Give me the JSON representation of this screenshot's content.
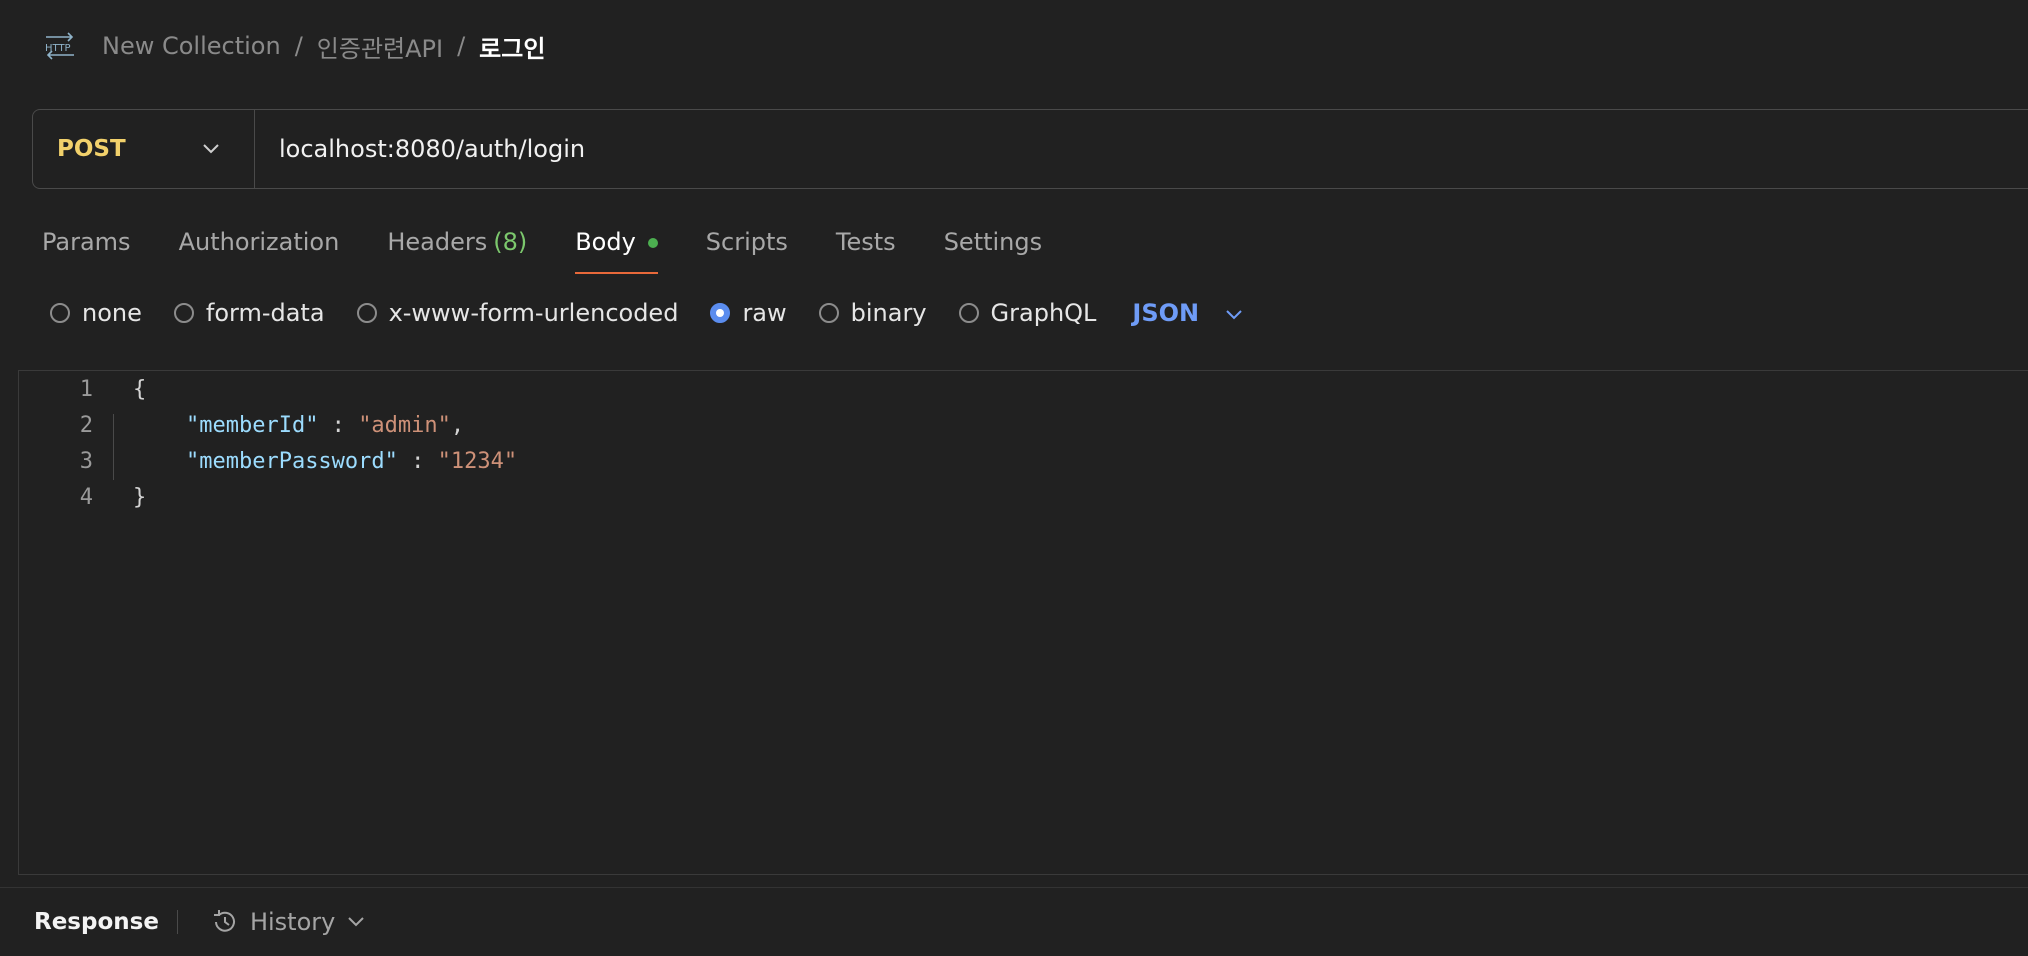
{
  "breadcrumb": {
    "items": [
      "New Collection",
      "인증관련API"
    ],
    "current": "로그인",
    "separator": "/",
    "icon": "http-icon",
    "icon_text": "HTTP"
  },
  "request": {
    "method": "POST",
    "url": "localhost:8080/auth/login"
  },
  "tabs": {
    "params": "Params",
    "authorization": "Authorization",
    "headers": "Headers",
    "headers_count": "(8)",
    "body": "Body",
    "scripts": "Scripts",
    "tests": "Tests",
    "settings": "Settings"
  },
  "body_modes": {
    "none": "none",
    "form_data": "form-data",
    "urlencoded": "x-www-form-urlencoded",
    "raw": "raw",
    "binary": "binary",
    "graphql": "GraphQL",
    "selected": "raw",
    "format": "JSON"
  },
  "editor": {
    "line_numbers": [
      "1",
      "2",
      "3",
      "4"
    ],
    "open_brace": "{",
    "close_brace": "}",
    "key1": "\"memberId\"",
    "val1": "\"admin\"",
    "key2": "\"memberPassword\"",
    "val2": "\"1234\""
  },
  "footer": {
    "response": "Response",
    "history": "History"
  },
  "colors": {
    "method": "#f2d16b",
    "accent_tab": "#e8693a",
    "format": "#6f9cf7",
    "json_key": "#9cdcfe",
    "json_string": "#ce9178",
    "body_dot": "#4caf50"
  }
}
